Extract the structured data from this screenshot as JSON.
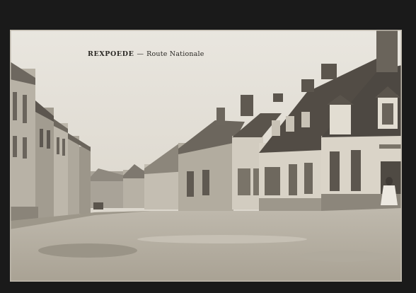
{
  "caption": {
    "place": "REXPOEDE",
    "separator": "—",
    "street": "Route Nationale"
  },
  "colors": {
    "sky": "#e6e2da",
    "road": "#b9b3a6",
    "roof_dark": "#4a4540",
    "wall": "#cfc9bd",
    "border": "#1a1a1a"
  }
}
